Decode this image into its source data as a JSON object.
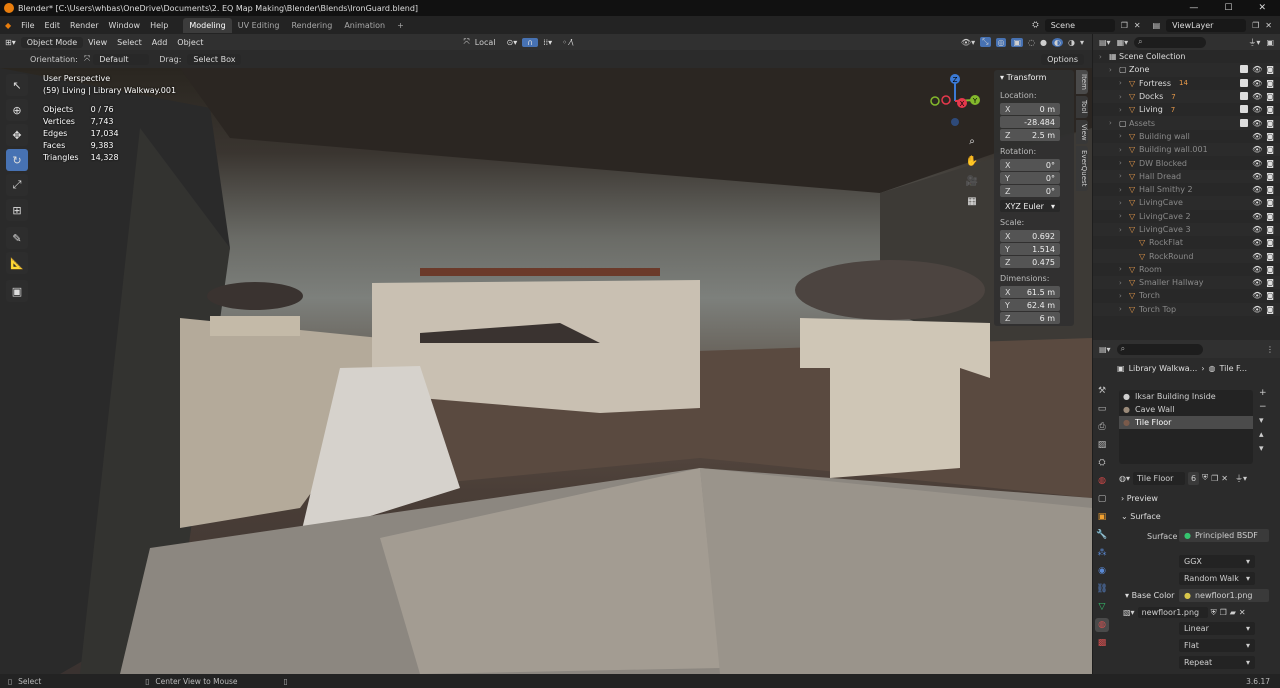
{
  "window": {
    "title": "Blender* [C:\\Users\\whbas\\OneDrive\\Documents\\2. EQ Map Making\\Blender\\Blends\\IronGuard.blend]",
    "controls": [
      "—",
      "☐",
      "✕"
    ]
  },
  "menubar": {
    "menus": [
      "File",
      "Edit",
      "Render",
      "Window",
      "Help"
    ],
    "workspaces": [
      "Modeling",
      "UV Editing",
      "Rendering",
      "Animation"
    ],
    "add_workspace": "+",
    "scene": "Scene",
    "view_layer": "ViewLayer"
  },
  "viewport_header": {
    "mode": "Object Mode",
    "menus": [
      "View",
      "Select",
      "Add",
      "Object"
    ],
    "transform_orientation": "Local"
  },
  "tool_settings": {
    "orientation_label": "Orientation:",
    "orientation_value": "Default",
    "drag_label": "Drag:",
    "drag_value": "Select Box",
    "options": "Options"
  },
  "viewport": {
    "perspective": "User Perspective",
    "active_object": "(59) Living | Library Walkway.001",
    "stats": [
      {
        "label": "Objects",
        "value": "0 / 76"
      },
      {
        "label": "Vertices",
        "value": "7,743"
      },
      {
        "label": "Edges",
        "value": "17,034"
      },
      {
        "label": "Faces",
        "value": "9,383"
      },
      {
        "label": "Triangles",
        "value": "14,328"
      }
    ],
    "gizmo_axes": [
      "Z",
      "X",
      "Y"
    ]
  },
  "npanel": {
    "title": "Transform",
    "location_label": "Location:",
    "location": [
      {
        "axis": "X",
        "value": "0 m"
      },
      {
        "axis": "",
        "value": "-28.484"
      },
      {
        "axis": "Z",
        "value": "2.5 m"
      }
    ],
    "rotation_label": "Rotation:",
    "rotation": [
      {
        "axis": "X",
        "value": "0°"
      },
      {
        "axis": "Y",
        "value": "0°"
      },
      {
        "axis": "Z",
        "value": "0°"
      }
    ],
    "rotation_mode": "XYZ Euler",
    "scale_label": "Scale:",
    "scale": [
      {
        "axis": "X",
        "value": "0.692"
      },
      {
        "axis": "Y",
        "value": "1.514"
      },
      {
        "axis": "Z",
        "value": "0.475"
      }
    ],
    "dimensions_label": "Dimensions:",
    "dimensions": [
      {
        "axis": "X",
        "value": "61.5 m"
      },
      {
        "axis": "Y",
        "value": "62.4 m"
      },
      {
        "axis": "Z",
        "value": "6 m"
      }
    ],
    "tabs": [
      "Item",
      "Tool",
      "View",
      "EverQuest"
    ]
  },
  "outliner": {
    "rows": [
      {
        "name": "Scene Collection",
        "indent": 0,
        "dim": false,
        "badge": ""
      },
      {
        "name": "Zone",
        "indent": 1,
        "dim": false,
        "badge": ""
      },
      {
        "name": "Fortress",
        "indent": 2,
        "dim": false,
        "badge": "14"
      },
      {
        "name": "Docks",
        "indent": 2,
        "dim": false,
        "badge": "7"
      },
      {
        "name": "Living",
        "indent": 2,
        "dim": false,
        "badge": "7"
      },
      {
        "name": "Assets",
        "indent": 1,
        "dim": true,
        "badge": ""
      },
      {
        "name": "Building wall",
        "indent": 2,
        "dim": true,
        "badge": ""
      },
      {
        "name": "Building wall.001",
        "indent": 2,
        "dim": true,
        "badge": ""
      },
      {
        "name": "DW Blocked",
        "indent": 2,
        "dim": true,
        "badge": ""
      },
      {
        "name": "Hall Dread",
        "indent": 2,
        "dim": true,
        "badge": ""
      },
      {
        "name": "Hall Smithy 2",
        "indent": 2,
        "dim": true,
        "badge": ""
      },
      {
        "name": "LivingCave",
        "indent": 2,
        "dim": true,
        "badge": ""
      },
      {
        "name": "LivingCave 2",
        "indent": 2,
        "dim": true,
        "badge": ""
      },
      {
        "name": "LivingCave 3",
        "indent": 2,
        "dim": true,
        "badge": ""
      },
      {
        "name": "RockFlat",
        "indent": 3,
        "dim": true,
        "badge": ""
      },
      {
        "name": "RockRound",
        "indent": 3,
        "dim": true,
        "badge": ""
      },
      {
        "name": "Room",
        "indent": 2,
        "dim": true,
        "badge": ""
      },
      {
        "name": "Smaller Hallway",
        "indent": 2,
        "dim": true,
        "badge": ""
      },
      {
        "name": "Torch",
        "indent": 2,
        "dim": true,
        "badge": ""
      },
      {
        "name": "Torch Top",
        "indent": 2,
        "dim": true,
        "badge": ""
      }
    ]
  },
  "properties": {
    "breadcrumb_object": "Library Walkwa...",
    "breadcrumb_material": "Tile F...",
    "material_slots": [
      "Iksar Building Inside",
      "Cave Wall",
      "Tile Floor"
    ],
    "material_name": "Tile Floor",
    "material_users": "6",
    "preview_label": "Preview",
    "surface_label": "Surface",
    "surface_field_label": "Surface",
    "surface_value": "Principled BSDF",
    "distribution": "GGX",
    "subsurface": "Random Walk",
    "base_color_label": "Base Color",
    "base_color_value": "newfloor1.png",
    "image_name": "newfloor1.png",
    "interpolation": "Linear",
    "projection": "Flat",
    "extension": "Repeat"
  },
  "statusbar": {
    "left_action": "Select",
    "middle_action": "Center View to Mouse",
    "version": "3.6.17"
  }
}
